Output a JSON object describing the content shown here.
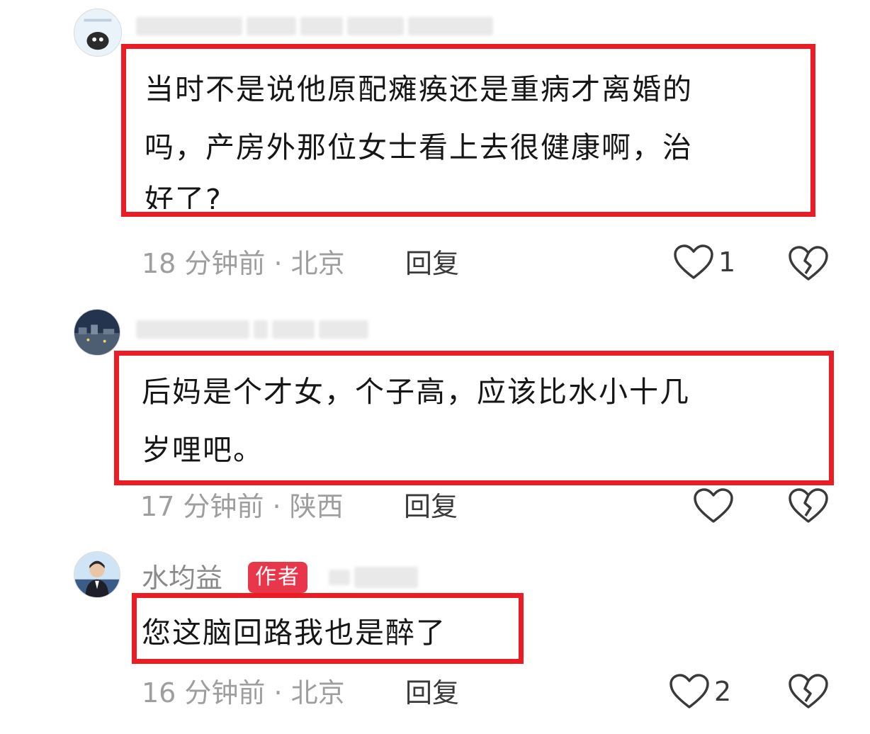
{
  "comments": [
    {
      "text_lines": [
        "当时不是说他原配瘫痪还是重病才离婚的",
        "吗，产房外那位女士看上去很健康啊，治",
        "好了?"
      ],
      "time_location": "18 分钟前 · 北京",
      "reply_label": "回复",
      "like_count": "1"
    },
    {
      "text_lines": [
        "后妈是个才女，个子高，应该比水小十几",
        "岁哩吧。"
      ],
      "time_location": "17 分钟前 · 陕西",
      "reply_label": "回复",
      "like_count": ""
    },
    {
      "author_name": "水均益",
      "author_badge": "作者",
      "text_lines": [
        "您这脑回路我也是醉了"
      ],
      "time_location": "16 分钟前 · 北京",
      "reply_label": "回复",
      "like_count": "2"
    }
  ],
  "colors": {
    "highlight_border": "#ec1c24",
    "author_badge_bg": "#e8364a",
    "meta_text": "#9e9e9e"
  },
  "icons": {
    "like": "heart-icon",
    "dislike": "broken-heart-icon"
  }
}
